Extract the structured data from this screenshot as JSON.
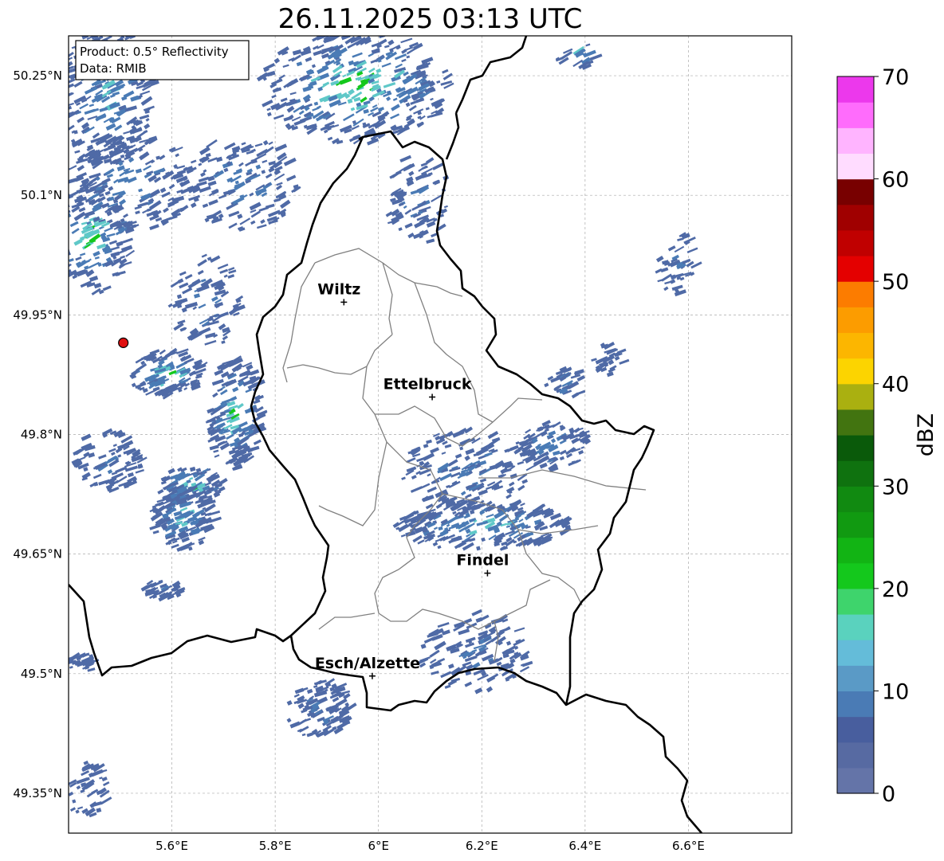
{
  "title": "26.11.2025 03:13 UTC",
  "info_box": {
    "product": "Product: 0.5° Reflectivity",
    "source": "Data: RMIB"
  },
  "map": {
    "lon_range": [
      5.4,
      6.8
    ],
    "lat_range": [
      49.3,
      50.3
    ],
    "lon_ticks": [
      {
        "value": 5.6,
        "label": "5.6°E"
      },
      {
        "value": 5.8,
        "label": "5.8°E"
      },
      {
        "value": 6.0,
        "label": "6°E"
      },
      {
        "value": 6.2,
        "label": "6.2°E"
      },
      {
        "value": 6.4,
        "label": "6.4°E"
      },
      {
        "value": 6.6,
        "label": "6.6°E"
      }
    ],
    "lat_ticks": [
      {
        "value": 50.25,
        "label": "50.25°N"
      },
      {
        "value": 50.1,
        "label": "50.1°N"
      },
      {
        "value": 49.95,
        "label": "49.95°N"
      },
      {
        "value": 49.8,
        "label": "49.8°N"
      },
      {
        "value": 49.65,
        "label": "49.65°N"
      },
      {
        "value": 49.5,
        "label": "49.5°N"
      },
      {
        "value": 49.35,
        "label": "49.35°N"
      }
    ],
    "radar_site": {
      "lon": 5.506,
      "lat": 49.915
    },
    "cities": [
      {
        "name": "Wiltz",
        "lon": 5.933,
        "lat": 49.966
      },
      {
        "name": "Ettelbruck",
        "lon": 6.104,
        "lat": 49.847
      },
      {
        "name": "Findel",
        "lon": 6.211,
        "lat": 49.626
      },
      {
        "name": "Esch/Alzette",
        "lon": 5.988,
        "lat": 49.497
      }
    ]
  },
  "colorbar": {
    "unit": "dBZ",
    "range": [
      0,
      70
    ],
    "tick_labels": [
      {
        "value": 0,
        "label": "0"
      },
      {
        "value": 10,
        "label": "10"
      },
      {
        "value": 20,
        "label": "20"
      },
      {
        "value": 30,
        "label": "30"
      },
      {
        "value": 40,
        "label": "40"
      },
      {
        "value": 50,
        "label": "50"
      },
      {
        "value": 60,
        "label": "60"
      },
      {
        "value": 70,
        "label": "70"
      }
    ],
    "colors": [
      "#6474a8",
      "#576aa2",
      "#485e9e",
      "#4a7bb5",
      "#5a9ac6",
      "#64bcd9",
      "#5ad2be",
      "#3ed46c",
      "#14c81c",
      "#12b414",
      "#119a11",
      "#118a11",
      "#0f720f",
      "#0a5a0a",
      "#427410",
      "#aab010",
      "#fcd400",
      "#fcb600",
      "#fc9c00",
      "#fc7c00",
      "#e40000",
      "#c00000",
      "#a00000",
      "#780000",
      "#ffdcff",
      "#ffb4ff",
      "#ff6cfc",
      "#ec38ec"
    ]
  },
  "echo_colors": {
    "weak": "#4f6aa6",
    "light": "#4a7bb5",
    "medium": "#5fc8c8",
    "strong": "#14c81c",
    "core": "#0f9a10"
  }
}
